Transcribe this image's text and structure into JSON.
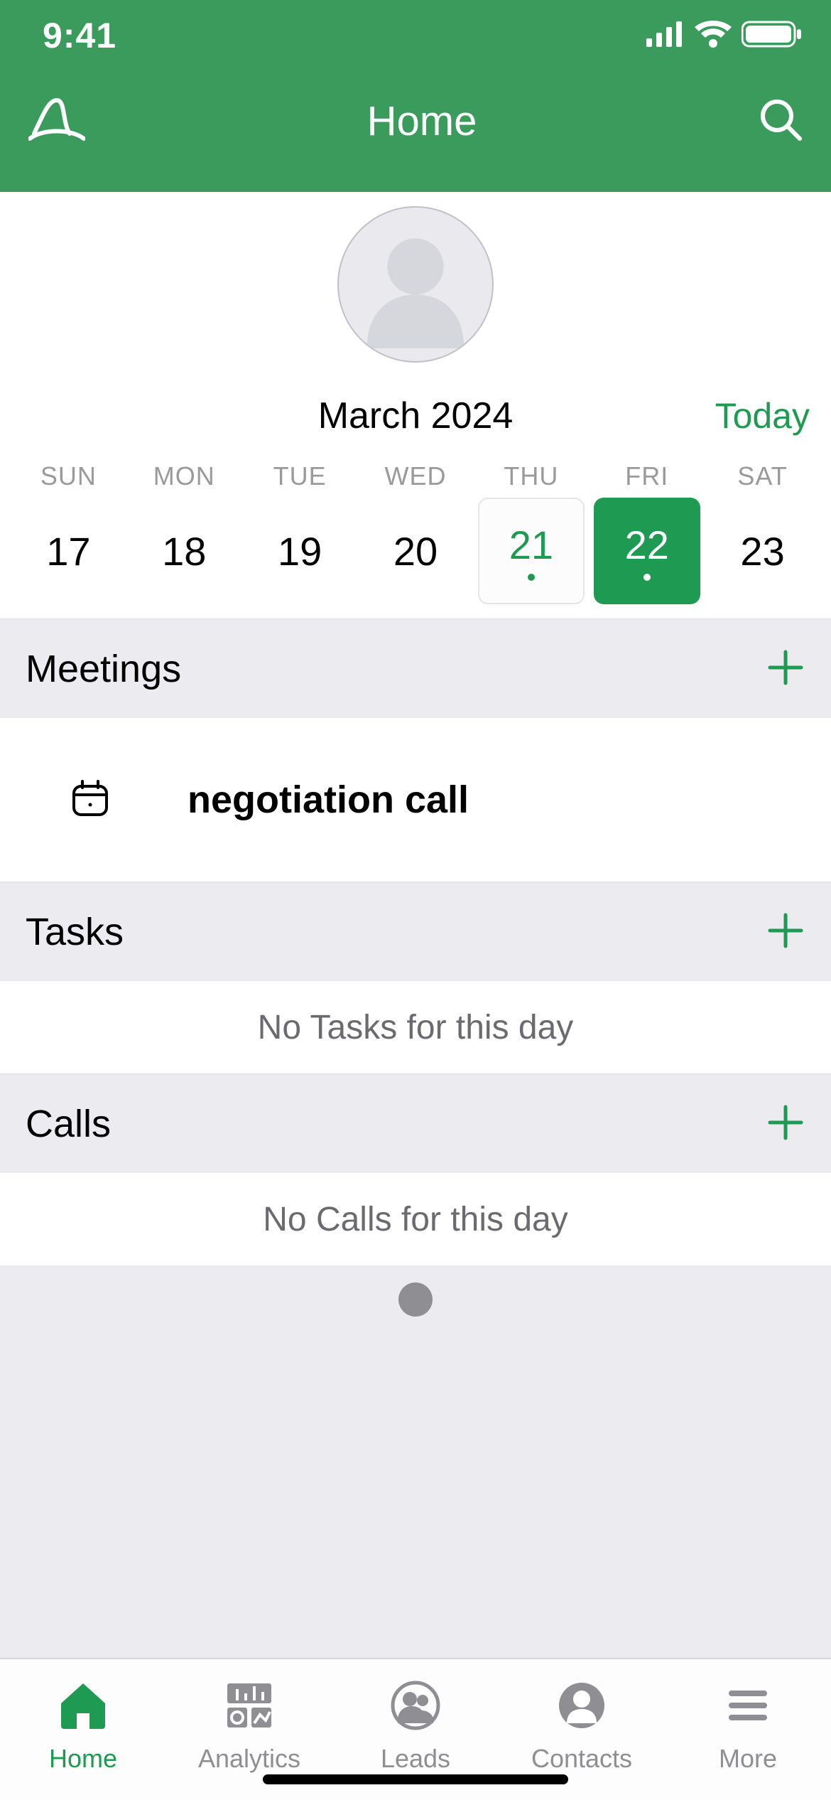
{
  "status": {
    "time": "9:41"
  },
  "header": {
    "title": "Home"
  },
  "calendar": {
    "month_label": "March 2024",
    "today_label": "Today",
    "day_names": [
      "SUN",
      "MON",
      "TUE",
      "WED",
      "THU",
      "FRI",
      "SAT"
    ],
    "dates": [
      "17",
      "18",
      "19",
      "20",
      "21",
      "22",
      "23"
    ],
    "current_index": 4,
    "selected_index": 5
  },
  "sections": {
    "meetings_label": "Meetings",
    "tasks_label": "Tasks",
    "calls_label": "Calls"
  },
  "meetings": [
    {
      "title": "negotiation call"
    }
  ],
  "empty_states": {
    "tasks": "No Tasks for this day",
    "calls": "No Calls for this day"
  },
  "tabs": {
    "home": "Home",
    "analytics": "Analytics",
    "leads": "Leads",
    "contacts": "Contacts",
    "more": "More",
    "active": "home"
  },
  "colors": {
    "brand_green": "#3a9b5d",
    "accent_green": "#1f9a53",
    "grey_text": "#8e8e93"
  }
}
